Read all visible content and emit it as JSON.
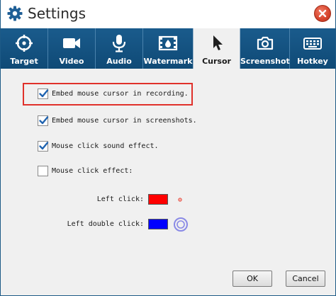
{
  "window": {
    "title": "Settings",
    "title_icon": "gear-icon",
    "close_icon": "close-icon"
  },
  "tabs": [
    {
      "id": "target",
      "label": "Target",
      "icon": "crosshair-icon",
      "active": false
    },
    {
      "id": "video",
      "label": "Video",
      "icon": "video-camera-icon",
      "active": false
    },
    {
      "id": "audio",
      "label": "Audio",
      "icon": "microphone-icon",
      "active": false
    },
    {
      "id": "watermark",
      "label": "Watermark",
      "icon": "watermark-icon",
      "active": false
    },
    {
      "id": "cursor",
      "label": "Cursor",
      "icon": "cursor-arrow-icon",
      "active": true
    },
    {
      "id": "screenshot",
      "label": "Screenshot",
      "icon": "camera-icon",
      "active": false
    },
    {
      "id": "hotkey",
      "label": "Hotkey",
      "icon": "keyboard-icon",
      "active": false
    }
  ],
  "cursor_settings": {
    "embed_cursor_recording": {
      "label": "Embed mouse cursor in recording.",
      "checked": true,
      "highlighted": true
    },
    "embed_cursor_screenshots": {
      "label": "Embed mouse cursor in screenshots.",
      "checked": true
    },
    "click_sound": {
      "label": "Mouse click sound effect.",
      "checked": true
    },
    "click_effect": {
      "label": "Mouse click effect:",
      "checked": false
    },
    "left_click": {
      "label": "Left click:",
      "color": "#ff0000",
      "preview": "small-dot-icon"
    },
    "left_double_click": {
      "label": "Left double click:",
      "color": "#0000ff",
      "preview": "double-ring-icon"
    }
  },
  "buttons": {
    "ok": "OK",
    "cancel": "Cancel"
  },
  "colors": {
    "toolbar": "#1a5b8c",
    "highlight": "#e0312b",
    "checkmark": "#1f63b0"
  }
}
